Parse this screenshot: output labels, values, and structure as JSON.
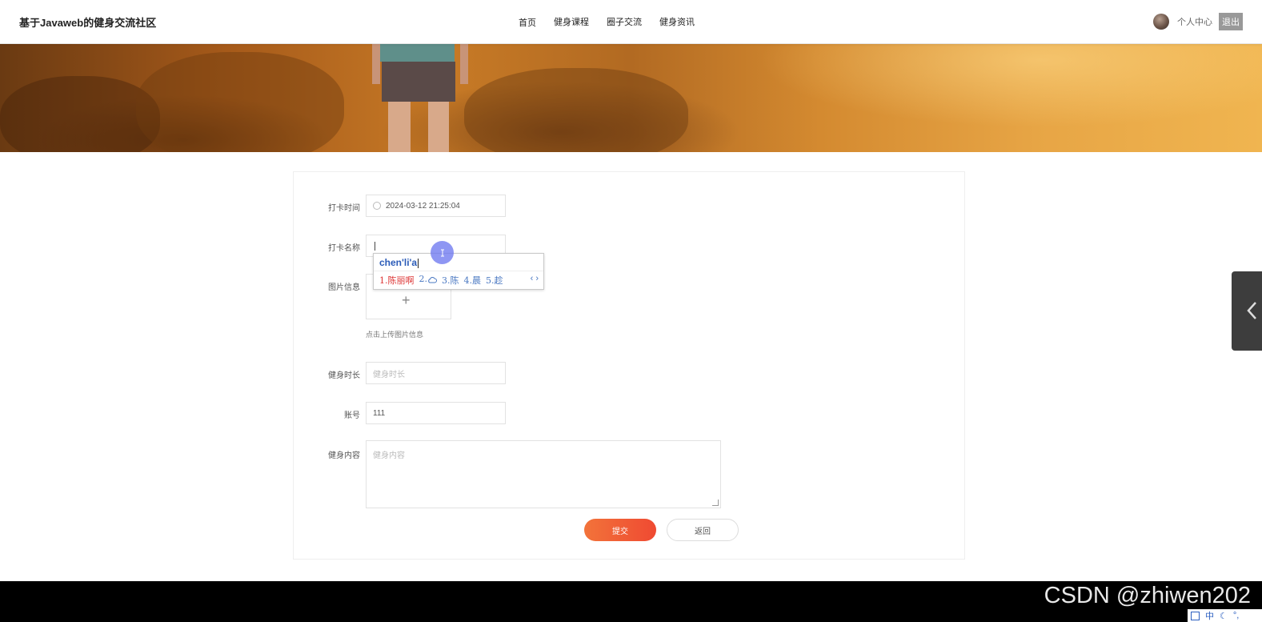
{
  "header": {
    "brand": "基于Javaweb的健身交流社区",
    "nav": [
      "首页",
      "健身课程",
      "圈子交流",
      "健身资讯"
    ],
    "profile_label": "个人中心",
    "logout_label": "退出"
  },
  "form": {
    "checkin_time": {
      "label": "打卡时间",
      "value": "2024-03-12 21:25:04"
    },
    "checkin_name": {
      "label": "打卡名称",
      "value": ""
    },
    "image": {
      "label": "图片信息",
      "hint": "点击上传图片信息"
    },
    "duration": {
      "label": "健身时长",
      "placeholder": "健身时长"
    },
    "account": {
      "label": "账号",
      "value": "111"
    },
    "content": {
      "label": "健身内容",
      "placeholder": "健身内容"
    },
    "submit_label": "提交",
    "back_label": "返回"
  },
  "ime": {
    "composition": "chen'li'a",
    "candidates": [
      "1.陈丽啊",
      "2.",
      "3.陈",
      "4.晨",
      "5.趁"
    ],
    "arrows": "‹ ›"
  },
  "watermark": "CSDN @zhiwen202",
  "tray": [
    "中"
  ]
}
